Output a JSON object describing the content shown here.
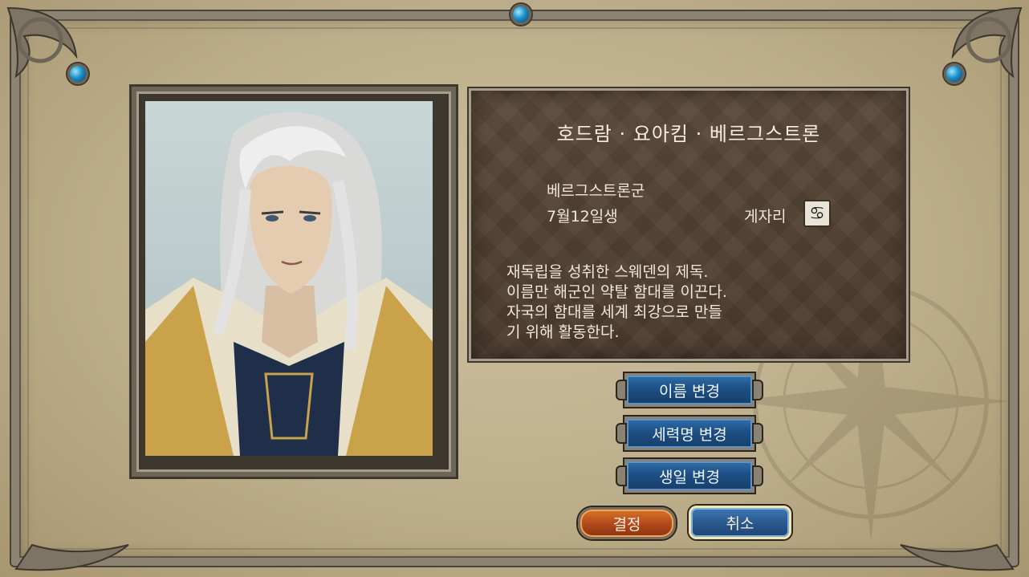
{
  "character": {
    "name": "호드람 · 요아킴 · 베르그스트론",
    "faction": "베르그스트론군",
    "birthday": "7월12일생",
    "zodiac_label": "게자리",
    "zodiac_icon": "cancer-zodiac-icon",
    "description": "재독립을 성취한 스웨덴의 제독.\n이름만 해군인 약탈 함대를 이끈다.\n자국의 함대를 세계 최강으로 만들\n기 위해 활동한다."
  },
  "buttons": {
    "change_name": "이름 변경",
    "change_faction_name": "세력명 변경",
    "change_birthday": "생일 변경",
    "confirm": "결정",
    "cancel": "취소"
  },
  "colors": {
    "gem": "#1c8fc9",
    "panel": "#4a3a2c",
    "button_blue": "#1d4f84",
    "button_orange": "#b0471a"
  }
}
